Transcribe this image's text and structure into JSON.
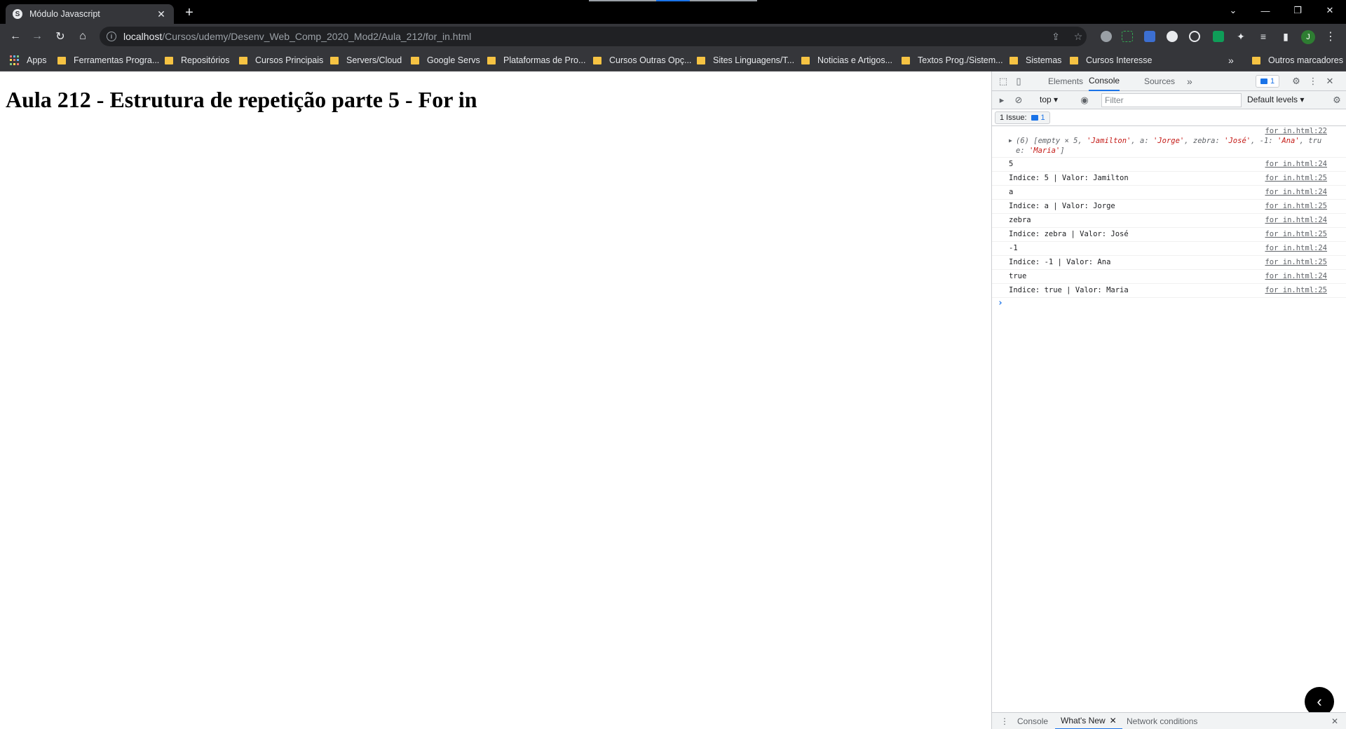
{
  "browser": {
    "tab": {
      "title": "Módulo Javascript",
      "favicon": "S"
    },
    "address": {
      "host": "localhost",
      "path": "/Cursos/udemy/Desenv_Web_Comp_2020_Mod2/Aula_212/for_in.html"
    },
    "profile_initial": "J",
    "bookmarks": [
      "Apps",
      "Ferramentas Progra...",
      "Repositórios",
      "Cursos Principais",
      "Servers/Cloud",
      "Google Servs",
      "Plataformas de Pro...",
      "Cursos Outras Opç...",
      "Sites Linguagens/T...",
      "Noticias e Artigos...",
      "Textos Prog./Sistem...",
      "Sistemas",
      "Cursos Interesse"
    ],
    "bookmarks_overflow": "»",
    "other_bookmarks": "Outros marcadores"
  },
  "page": {
    "heading": "Aula 212 - Estrutura de repetição parte 5 - For in"
  },
  "devtools": {
    "tabs": [
      "Elements",
      "Console",
      "Sources"
    ],
    "more_tabs": "»",
    "issues_badge_count": "1",
    "context": "top",
    "filter_placeholder": "Filter",
    "levels": "Default levels",
    "issues_label": "1 Issue:",
    "issues_count": "1",
    "console": {
      "object_log": {
        "source": "for in.html:22",
        "prefix": "(6) [empty × 5, ",
        "s1": "'Jamilton'",
        "mid1": ", a: ",
        "s2": "'Jorge'",
        "mid2": ", zebra: ",
        "s3": "'José'",
        "mid3": ", -1: ",
        "s4": "'Ana'",
        "mid4": ", true: ",
        "s5": "'Maria'",
        "suffix": "]"
      },
      "lines": [
        {
          "text": "5",
          "source": "for in.html:24"
        },
        {
          "text": "Indice: 5 | Valor: Jamilton",
          "source": "for in.html:25"
        },
        {
          "text": "a",
          "source": "for in.html:24"
        },
        {
          "text": "Indice: a | Valor: Jorge",
          "source": "for in.html:25"
        },
        {
          "text": "zebra",
          "source": "for in.html:24"
        },
        {
          "text": "Indice: zebra | Valor: José",
          "source": "for in.html:25"
        },
        {
          "text": "-1",
          "source": "for in.html:24"
        },
        {
          "text": "Indice: -1 | Valor: Ana",
          "source": "for in.html:25"
        },
        {
          "text": "true",
          "source": "for in.html:24"
        },
        {
          "text": "Indice: true | Valor: Maria",
          "source": "for in.html:25"
        }
      ],
      "prompt": "›"
    },
    "drawer_tabs": [
      "Console",
      "What's New",
      "Network conditions"
    ]
  },
  "colors": {
    "tab_bg": "#35363a",
    "frame_bg": "#000000",
    "accent": "#1a73e8",
    "string_red": "#c41a16",
    "folder_yellow": "#f6c343"
  }
}
